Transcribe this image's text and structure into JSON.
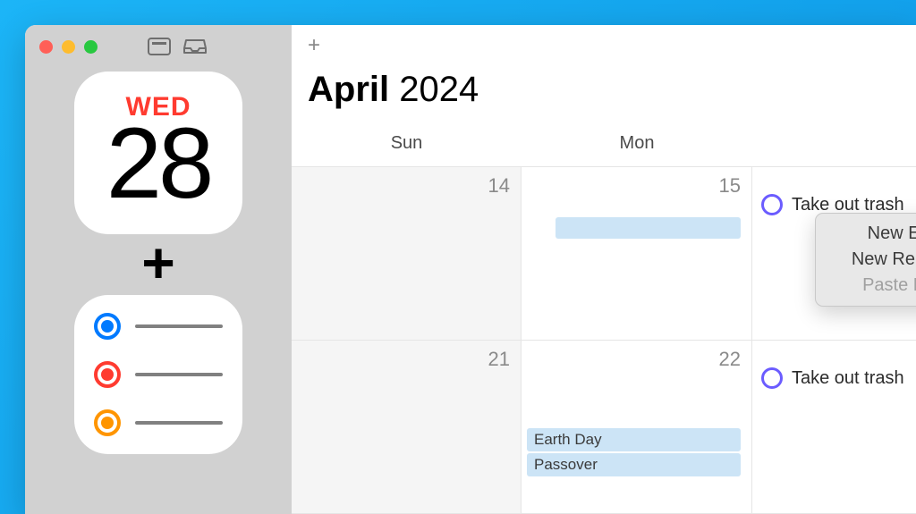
{
  "sidebar": {
    "calendar_widget": {
      "day_label": "WED",
      "day_number": "28"
    },
    "joiner": "+"
  },
  "toolbar": {
    "add_glyph": "+"
  },
  "header": {
    "month": "April",
    "year": "2024"
  },
  "day_headers": [
    "Sun",
    "Mon"
  ],
  "weeks": [
    {
      "cells": [
        {
          "day": "14"
        },
        {
          "day": "15"
        },
        {
          "reminder": "Take out trash"
        }
      ]
    },
    {
      "cells": [
        {
          "day": "21"
        },
        {
          "day": "22",
          "events": [
            "Earth Day",
            "Passover"
          ]
        },
        {
          "reminder": "Take out trash"
        }
      ]
    }
  ],
  "context_menu": {
    "items": [
      {
        "label": "New Event",
        "enabled": true
      },
      {
        "label": "New Reminder",
        "enabled": true
      },
      {
        "label": "Paste Event",
        "enabled": false
      }
    ]
  }
}
